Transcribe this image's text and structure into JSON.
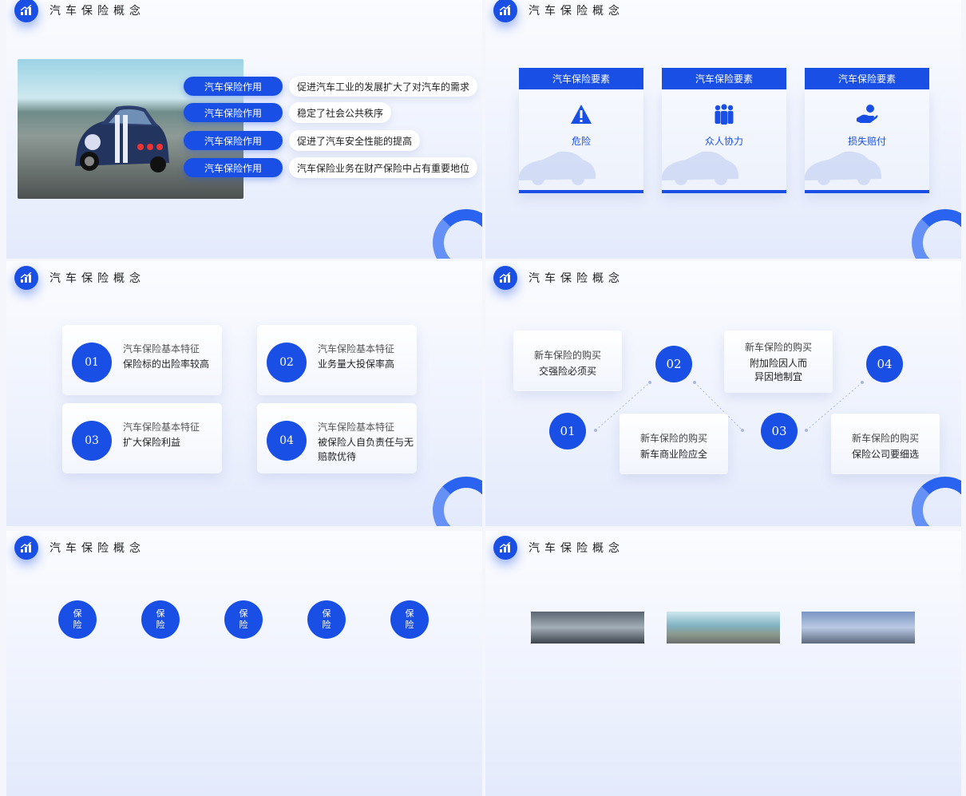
{
  "header": {
    "title": "汽车保险概念"
  },
  "slide1": {
    "rows": [
      {
        "tag": "汽车保险作用",
        "text": "促进汽车工业的发展扩大了对汽车的需求"
      },
      {
        "tag": "汽车保险作用",
        "text": "稳定了社会公共秩序"
      },
      {
        "tag": "汽车保险作用",
        "text": "促进了汽车安全性能的提高"
      },
      {
        "tag": "汽车保险作用",
        "text": "汽车保险业务在财产保险中占有重要地位"
      }
    ]
  },
  "slide2": {
    "cards": [
      {
        "header": "汽车保险要素",
        "label": "危险",
        "icon": "warning-icon"
      },
      {
        "header": "汽车保险要素",
        "label": "众人协力",
        "icon": "people-icon"
      },
      {
        "header": "汽车保险要素",
        "label": "损失赔付",
        "icon": "hand-money-icon"
      }
    ]
  },
  "slide3": {
    "features": [
      {
        "num": "01",
        "title": "汽车保险基本特征",
        "desc": "保险标的出险率较高"
      },
      {
        "num": "02",
        "title": "汽车保险基本特征",
        "desc": "业务量大投保率高"
      },
      {
        "num": "03",
        "title": "汽车保险基本特征",
        "desc": "扩大保险利益"
      },
      {
        "num": "04",
        "title": "汽车保险基本特征",
        "desc": "被保险人自负责任与无赔款优待"
      }
    ]
  },
  "slide4": {
    "steps": [
      {
        "num": "01",
        "title": "新车保险的购买",
        "desc": "交强险必须买"
      },
      {
        "num": "02",
        "title": "新车保险的购买",
        "desc": "新车商业险应全"
      },
      {
        "num": "03",
        "title": "新车保险的购买",
        "desc": "附加险因人而异因地制宜"
      },
      {
        "num": "04",
        "title": "新车保险的购买",
        "desc": "保险公司要细选"
      }
    ]
  },
  "slide5": {
    "bubbles": [
      "保险",
      "保险",
      "保险",
      "保险",
      "保险"
    ]
  },
  "colors": {
    "accent": "#1a4fe6",
    "background": "#eef2fd"
  }
}
